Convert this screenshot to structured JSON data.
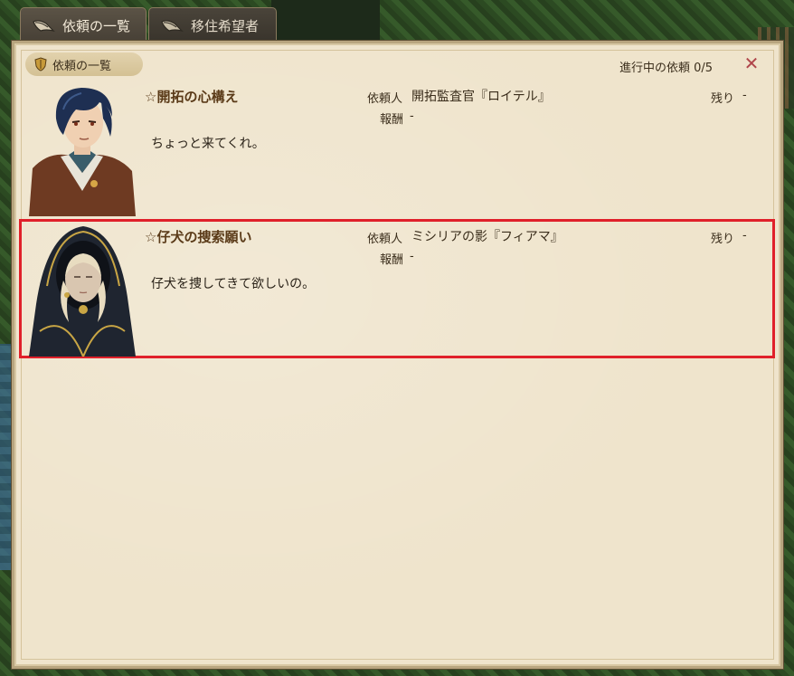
{
  "tabs": [
    {
      "label": "依頼の一覧",
      "icon": "scroll-icon",
      "active": true
    },
    {
      "label": "移住希望者",
      "icon": "scroll-icon",
      "active": false
    }
  ],
  "panel": {
    "header_label": "依頼の一覧",
    "header_icon": "shield-icon",
    "progress_text": "進行中の依頼 0/5",
    "close_icon": "close-icon",
    "close_symbol": "✕"
  },
  "requests": [
    {
      "title": "☆開拓の心構え",
      "client_label": "依頼人",
      "client_name": "開拓監査官『ロイテル』",
      "reward_label": "報酬",
      "reward_value": "-",
      "remaining_label": "残り",
      "remaining_value": "-",
      "description": "ちょっと来てくれ。",
      "portrait": "portrait-roitel",
      "selected": false
    },
    {
      "title": "☆仔犬の捜索願い",
      "client_label": "依頼人",
      "client_name": "ミシリアの影『フィアマ』",
      "reward_label": "報酬",
      "reward_value": "-",
      "remaining_label": "残り",
      "remaining_value": "-",
      "description": "仔犬を捜してきて欲しいの。",
      "portrait": "portrait-fiama",
      "selected": true
    }
  ],
  "colors": {
    "panel_bg": "#efe4cc",
    "title_color": "#5a3a18",
    "selection_border": "#e0202a",
    "close_color": "#b0464b"
  }
}
